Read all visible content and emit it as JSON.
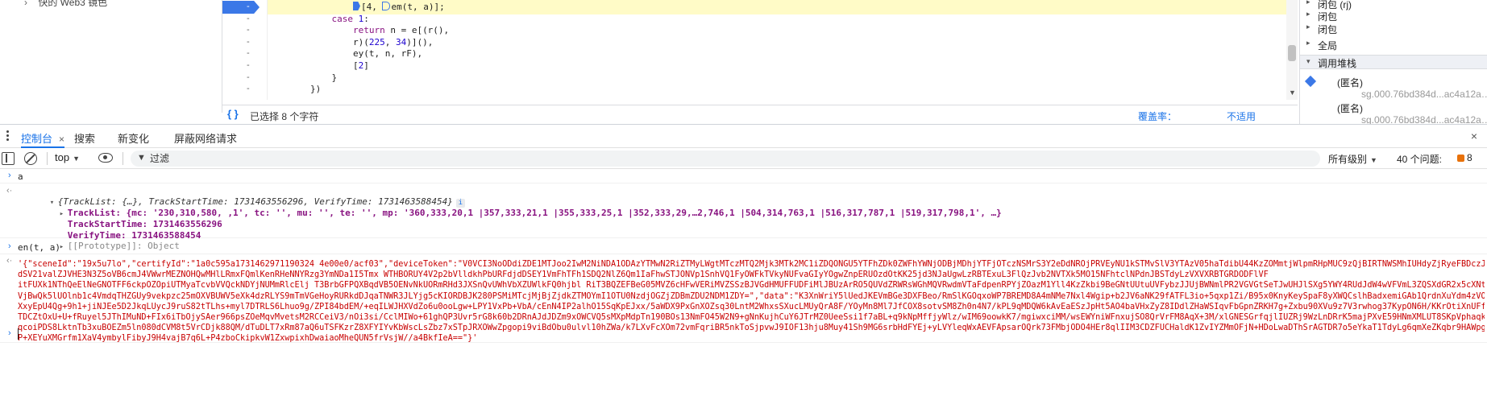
{
  "sources_nav": {
    "label": "快的 Web3 镜色"
  },
  "editor": {
    "code_lines": [
      {
        "indent": "                ",
        "parts": [
          [
            "paused",
            ""
          ],
          [
            "txt",
            "[4, "
          ],
          [
            "dmark",
            ""
          ],
          [
            "txt",
            "em(t, a)];"
          ]
        ],
        "highlight": true
      },
      {
        "indent": "            ",
        "parts": [
          [
            "kw",
            "case "
          ],
          [
            "num",
            "1"
          ],
          [
            "txt",
            ":"
          ]
        ]
      },
      {
        "indent": "                ",
        "parts": [
          [
            "kw",
            "return "
          ],
          [
            "txt",
            "n = e[(r(),"
          ]
        ]
      },
      {
        "indent": "                ",
        "parts": [
          [
            "txt",
            "r)("
          ],
          [
            "num",
            "225"
          ],
          [
            "txt",
            ", "
          ],
          [
            "num",
            "34"
          ],
          [
            "txt",
            ")]("
          ],
          [
            "txt",
            "),"
          ]
        ]
      },
      {
        "indent": "                ",
        "parts": [
          [
            "txt",
            "ey(t, n, rF),"
          ]
        ]
      },
      {
        "indent": "                ",
        "parts": [
          [
            "txt",
            "["
          ],
          [
            "num",
            "2"
          ],
          [
            "txt",
            "]"
          ]
        ]
      },
      {
        "indent": "            ",
        "parts": [
          [
            "txt",
            "}"
          ]
        ]
      },
      {
        "indent": "        ",
        "parts": [
          [
            "txt",
            "})"
          ]
        ]
      }
    ],
    "gutter": [
      "-",
      "-",
      "-",
      "-",
      "-",
      "-",
      "-",
      "-"
    ],
    "status_selection": "已选择 8 个字符",
    "coverage_label": "覆盖率：",
    "coverage_value": "不适用"
  },
  "scope": {
    "items": [
      {
        "label": "闭包 (rj)",
        "tri": "▸"
      },
      {
        "label": "闭包",
        "tri": "▸"
      },
      {
        "label": "闭包",
        "tri": "▸"
      },
      {
        "label": "全局",
        "tri": "▸"
      }
    ],
    "callstack_header": "调用堆栈",
    "frames": [
      {
        "name": "(匿名)",
        "location": "sg.000.76bd384d...ac4a12a…"
      },
      {
        "name": "(匿名)",
        "location": "sg.000.76bd384d...ac4a12a…"
      }
    ]
  },
  "drawer": {
    "tabs": [
      "控制台",
      "搜索",
      "新变化",
      "屏蔽网络请求"
    ],
    "active_tab": 0,
    "close_glyph": "×"
  },
  "toolbar": {
    "context": "top",
    "filter_placeholder": "过滤",
    "levels": "所有级别",
    "issues": "40 个问题:",
    "issue_badge": "8"
  },
  "console": {
    "cmd1": "a",
    "obj_summary": "{TrackList: {…}, TrackStartTime: 1731463556296, VerifyTime: 1731463588454}",
    "tracklist_line": "TrackList: {mc: '230,310,580, ,1', tc: '', mu: '', te: '', mp: '360,333,20,1 |357,333,21,1 |355,333,25,1 |352,333,29,…2,746,1 |504,314,763,1 |516,317,787,1 |519,317,798,1', …}",
    "trackstart_line": "TrackStartTime: 1731463556296",
    "verify_line": "VerifyTime: 1731463588454",
    "proto_line": "[[Prototype]]: Object",
    "cmd2": "en(t, a)",
    "result_lines": [
      "'{\"sceneId\":\"19x5u7lo\",\"certifyId\":\"1a0c595a1731462971190324 4e00e0/acf03\",\"deviceToken\":\"V0VCI3NoODdiZDE1MTJoo2IwM2NiNDA1ODAzYTMwN2RiZTMyLWgtMTczMTQ2Mjk3MTk2MC1iZDQONGU5YTFhZDk0ZWFhYWNjODBjMDhjYTFjOTczNSMrS3Y2eDdNROjPRVEyNU1kSTMvSlV3YTAzV05haTdibU44KzZOMmtjWlpmRHpMUC9zQjBIRTNWSMhIUHdyZjRyeFBDczJzNkF4OFB",
      "dSV21valZJVHE3N3Z5oVB6cmJ4VWwrMEZNOHQwMHlLRmxFQmlKenRHeNNYRzg3YmNDa1I5Tmx WTHBORUY4V2p2bVlldkhPbURFdjdDSEY1VmFhTFh1SDQ2NlZ6Qm1IaFhwSTJONVp1SnhVQ1FyOWFkTVkyNUFvaGIyYOgwZnpERUOzdOtKK25jd3NJaUgwLzRBTExuL3FlQzJvb2NVTXk5MO15NFhtclNPdnJBSTdyLzVXVXRBTGRDODFlVF",
      "itFUXk1NThQeElNeGNOTFF6ckpOZOpiUTMyaTcvbVVQckNDYjNUMmRlcElj T3BrbGFPQXBqdVB5OENvNkUORmRHd3JXSnQvUWhVbXZUWlkFQ0hjbl RiT3BQZEFBeG05MVZ6cHFwVERiMVZSSzBJVGdHMUFFUDFiMlJBUzArRO5QUVdZRWRsWGhMQVRwdmVTaFdpenRPYjZOazM1Yll4KzZkbi9BeGNtUUtuUVFybzJJUjBWNmlPR2VGVGtSeTJwUHJlSXg5YWY4RUdJdW4wVFVmL3ZQSXdGR2x5cXNteDUST1FCV",
      "VjBwQk5lUOlnb1c4VmdqTHZGUy9vekpzc25mOXVBUWV5eXk4dzRLYS9mTmVGeHoyRURkdDJqaTNWR3JLYjg5cKIORDBJK280PSMiMTcjMjBjZjdkZTMOYmI1OTU0NzdjOGZjZDBmZDU2NDM1ZDY=\",\"data\":\"K3XnWriY5lUedJKEVmBGe3DXFBeo/RmSlKGOqxoWP7BREMD8A4mNMe7Nxl4Wgip+b2JV6aNK29fATFL3io+5qxp1Zi/B95x0KnyKeySpaF8yXWQCslhBadxemiGAb1QrdnXuYdm4zVOOGTajD0",
      "XxyEpU4Qg+9h1+jiNJEe5D2JkqLUycJ9ruS82tTLhs+myl7DTRLS6Lhuo9g/ZPI84bdEM/+eqILWJHXVdZo6u0ooLgw+LPY1VxPb+VbA/cEnN4IP2alhO15SqKpEJxx/5aWDX9PxGnXOZsq30LntM2WhxsSXucLMUyQrA8F/YOyMn8Ml7JfCOX8sotvSM8Zh0n4N7/kPL9qMDQW6kAvEaESzJpHt5AO4baVHxZyZ8IDdlZHaWSIqvFbGpnZRKH7g+Zxbu90XVu9z7V3rwhog37KypON6H/KKrOtiXnUFfika9se",
      "TDCZtOxU+U+fRuyel5JThIMuND+FIx6iTbOjySAer966psZOeMqvMvetsM2RCCeiV3/nOi3si/CclMIWo+61ghQP3Uvr5rG8k60b2DRnAJdJDZm9xOWCVQ5sMXpMdpTn190BOs13NmFO45W2N9+gNnKujhCuY6JTrMZ0UeeSsi1f7aBL+q9kNpMffjyWlz/wIM69oowkK7/mgiwxciMM/wsEWYniWFnxujSO8QrVrFM8AqX+3M/xlGNESGrfqjlIUZRj9WzLnDRrK5majPXvE59HNmXMLUT8SKpVphaqk08V2kZp",
      "qcoiPDS8LktnTb3xuBOEZm5ln080dCVM8t5VrCDjk88QM/dTuDLT7xRm87aQ6uTSFKzrZ8XFYIYvKbWscLsZbz7xSTpJRXOWwZpgopi9viBdObu0ulvl10hZWa/k7LXvFcXOm72vmFqriBR5nkToSjpvwJ9IOF13hju8Muy41Sh9MG6srbHdFYEj+yLVYleqWxAEVFApsarOQrk73FMbjODO4HEr8qlIIM3CDZFUCHaldK1ZvIYZMmOFjN+HDoLwaDThSrAGTDR7o5eYkaT1TdyLg6qmXeZKqbr9HAWpg4WHxCfz",
      "P+XEYuXMGrfm1XaV4ymbylFibyJ9H4vajB7q6L+P4zboCkipkvW1ZxwpixhDwaiaoMheQUN5frVsjW//a4BkfIeA==\"}'"
    ]
  }
}
